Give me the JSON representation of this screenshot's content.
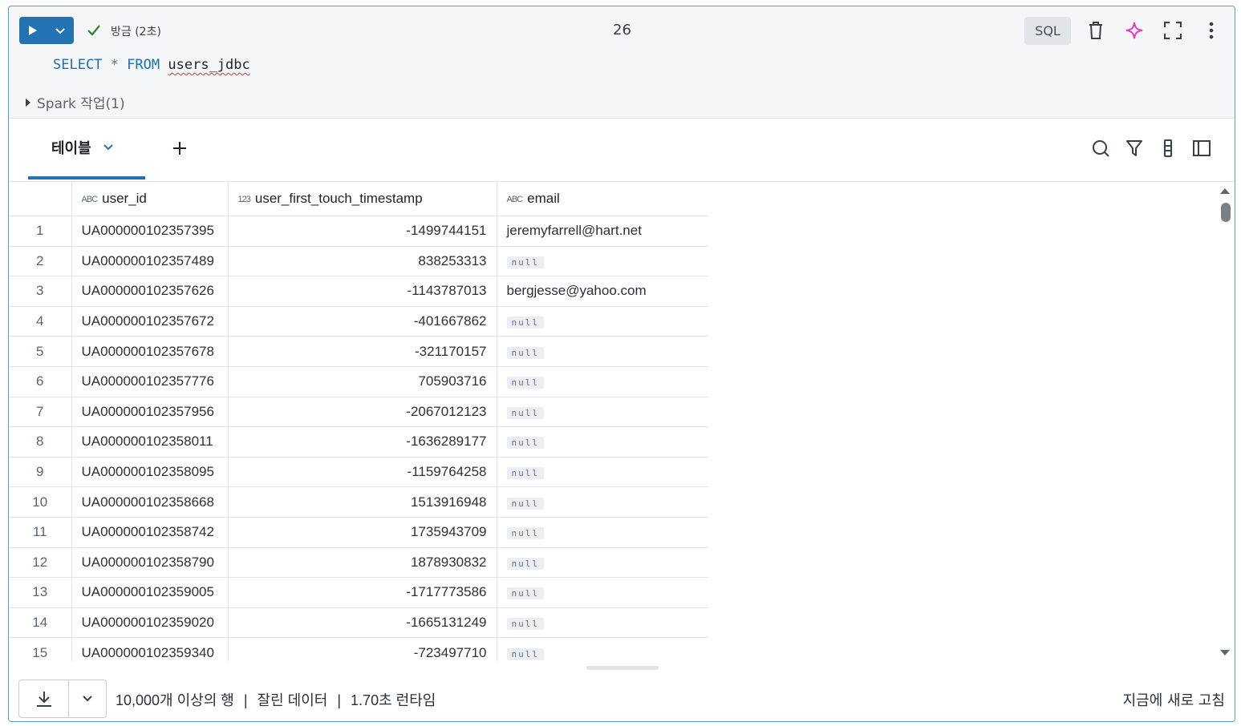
{
  "editor": {
    "status_text": "방금 (2초)",
    "cell_number": "26",
    "language_badge": "SQL",
    "code": {
      "kw_select": "SELECT",
      "star": "*",
      "kw_from": "FROM",
      "table": "users_jdbc"
    },
    "spark_jobs": "Spark 작업(1)"
  },
  "results": {
    "active_tab": "테이블",
    "columns": [
      {
        "type_icon": "ABC",
        "name": "user_id"
      },
      {
        "type_icon": "123",
        "name": "user_first_touch_timestamp"
      },
      {
        "type_icon": "ABC",
        "name": "email"
      }
    ],
    "null_label": "null",
    "rows": [
      {
        "n": "1",
        "user_id": "UA000000102357395",
        "ts": "-1499744151",
        "email": "jeremyfarrell@hart.net"
      },
      {
        "n": "2",
        "user_id": "UA000000102357489",
        "ts": "838253313",
        "email": null
      },
      {
        "n": "3",
        "user_id": "UA000000102357626",
        "ts": "-1143787013",
        "email": "bergjesse@yahoo.com"
      },
      {
        "n": "4",
        "user_id": "UA000000102357672",
        "ts": "-401667862",
        "email": null
      },
      {
        "n": "5",
        "user_id": "UA000000102357678",
        "ts": "-321170157",
        "email": null
      },
      {
        "n": "6",
        "user_id": "UA000000102357776",
        "ts": "705903716",
        "email": null
      },
      {
        "n": "7",
        "user_id": "UA000000102357956",
        "ts": "-2067012123",
        "email": null
      },
      {
        "n": "8",
        "user_id": "UA000000102358011",
        "ts": "-1636289177",
        "email": null
      },
      {
        "n": "9",
        "user_id": "UA000000102358095",
        "ts": "-1159764258",
        "email": null
      },
      {
        "n": "10",
        "user_id": "UA000000102358668",
        "ts": "1513916948",
        "email": null
      },
      {
        "n": "11",
        "user_id": "UA000000102358742",
        "ts": "1735943709",
        "email": null
      },
      {
        "n": "12",
        "user_id": "UA000000102358790",
        "ts": "1878930832",
        "email": null
      },
      {
        "n": "13",
        "user_id": "UA000000102359005",
        "ts": "-1717773586",
        "email": null
      },
      {
        "n": "14",
        "user_id": "UA000000102359020",
        "ts": "-1665131249",
        "email": null
      },
      {
        "n": "15",
        "user_id": "UA000000102359340",
        "ts": "-723497710",
        "email": null
      }
    ]
  },
  "footer": {
    "row_count": "10,000개 이상의 행",
    "truncated": "잘린 데이터",
    "runtime": "1.70초 런타임",
    "separator": "|",
    "refreshed": "지금에 새로 고침"
  },
  "colors": {
    "accent": "#2272b4",
    "success": "#2e7d32",
    "keyword": "#1a6fb4",
    "assistant_pink": "#e23ec0",
    "assistant_purple": "#7a4df0"
  }
}
